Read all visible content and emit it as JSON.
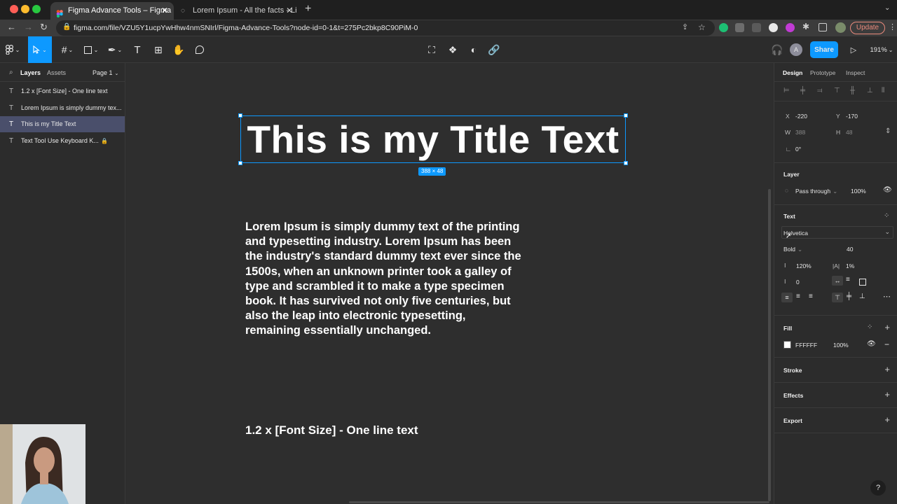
{
  "browser": {
    "tabs": [
      {
        "title": "Figma Advance Tools – Figma",
        "close": "✕"
      },
      {
        "title": "Lorem Ipsum - All the facts - Li",
        "close": "✕"
      }
    ],
    "new_tab": "+",
    "url": "figma.com/file/VZU5Y1ucpYwHhw4nmSNIrl/Figma-Advance-Tools?node-id=0-1&t=275Pc2bkp8C90PiM-0",
    "update_label": "Update"
  },
  "toolbar": {
    "avatar_letter": "A",
    "share_label": "Share",
    "zoom": "191%"
  },
  "left_panel": {
    "tabs": [
      "Layers",
      "Assets"
    ],
    "page": "Page 1",
    "layers": [
      {
        "name": "1.2 x [Font Size] - One line text",
        "type_icon": "T"
      },
      {
        "name": "Lorem Ipsum is simply dummy tex...",
        "type_icon": "T"
      },
      {
        "name": "This is my Title Text",
        "type_icon": "T",
        "selected": true
      },
      {
        "name": "Text Tool Use Keyboard K...",
        "type_icon": "T",
        "locked": true
      }
    ]
  },
  "canvas": {
    "title_text": "This is my Title Text",
    "size_badge": "388 × 48",
    "body_lines": [
      "Lorem Ipsum is simply dummy text of the printing",
      "and typesetting industry. Lorem Ipsum has been",
      "the industry's standard dummy text ever since the",
      "1500s, when an unknown printer took a galley of",
      "type and scrambled it to make a type specimen",
      "book. It has survived not only five centuries, but",
      "also the leap into electronic typesetting,",
      "remaining essentially unchanged."
    ],
    "footer_text": "1.2 x [Font Size] - One line text"
  },
  "right_panel": {
    "tabs": [
      "Design",
      "Prototype",
      "Inspect"
    ],
    "x_label": "X",
    "x_value": "-220",
    "y_label": "Y",
    "y_value": "-170",
    "w_label": "W",
    "w_value": "388",
    "h_label": "H",
    "h_value": "48",
    "rotation": "0°",
    "layer": {
      "heading": "Layer",
      "blend": "Pass through",
      "opacity": "100%"
    },
    "text": {
      "heading": "Text",
      "font_family": "Helvetica",
      "font_weight": "Bold",
      "font_size": "40",
      "line_height": "120%",
      "letter_spacing_icon": "|A|",
      "letter_spacing": "1%",
      "paragraph_spacing": "0"
    },
    "fill": {
      "heading": "Fill",
      "hex": "FFFFFF",
      "opacity": "100%"
    },
    "stroke_heading": "Stroke",
    "effects_heading": "Effects",
    "export_heading": "Export"
  },
  "help": "?",
  "colors": {
    "accent": "#0d99ff",
    "fill_swatch": "#ffffff",
    "update": "#ea8a7c"
  }
}
